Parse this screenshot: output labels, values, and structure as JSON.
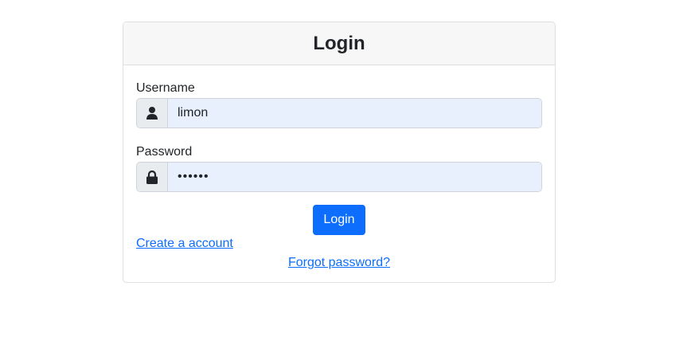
{
  "login_card": {
    "title": "Login",
    "username": {
      "label": "Username",
      "value": "limon",
      "icon": "user-icon"
    },
    "password": {
      "label": "Password",
      "value": "••••••",
      "icon": "lock-icon"
    },
    "submit_label": "Login",
    "create_account_link": "Create a account",
    "forgot_password_link": "Forgot password?"
  },
  "colors": {
    "primary": "#0d6efd",
    "header_bg": "#f7f7f7",
    "autofill_bg": "#e8f0fe",
    "addon_bg": "#e9ecef"
  }
}
